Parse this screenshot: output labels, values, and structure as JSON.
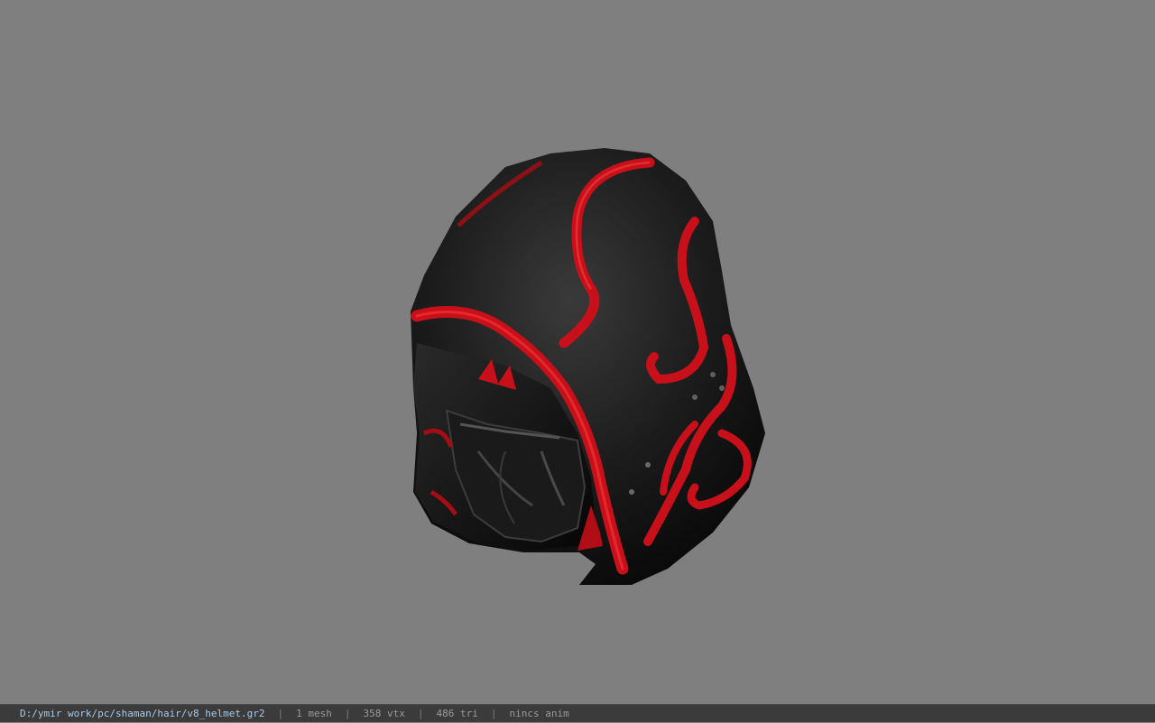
{
  "viewport": {
    "background_color": "#7f7f7f",
    "model_name": "helmet"
  },
  "status_bar": {
    "file_path": "D:/ymir work/pc/shaman/hair/v8_helmet.gr2",
    "separator": "|",
    "mesh_count": "1 mesh",
    "vertex_count": "358 vtx",
    "triangle_count": "486 tri",
    "animation": "nincs anim"
  },
  "colors": {
    "hood_black": "#161616",
    "hood_red": "#c8101a",
    "status_bg": "#3b3b3b",
    "path_text": "#a9c9e6",
    "stat_text": "#9a9a9a"
  }
}
